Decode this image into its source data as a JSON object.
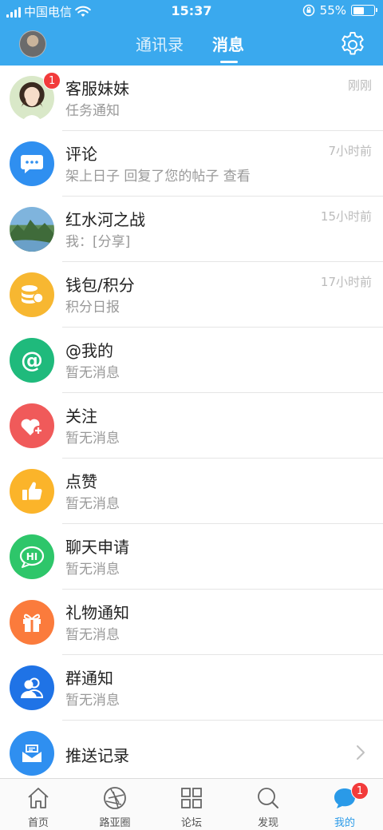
{
  "status_bar": {
    "carrier": "中国电信",
    "time": "15:37",
    "battery_percent": "55%",
    "battery_level": 0.55
  },
  "nav": {
    "tabs": [
      {
        "label": "通讯录",
        "active": false
      },
      {
        "label": "消息",
        "active": true
      }
    ],
    "settings_icon": "gear-icon"
  },
  "messages": [
    {
      "title": "客服妹妹",
      "subtitle": "任务通知",
      "time": "刚刚",
      "badge": "1",
      "icon": "avatar-photo"
    },
    {
      "title": "评论",
      "subtitle": "架上日子 回复了您的帖子   查看",
      "time": "7小时前",
      "icon": "comment-icon",
      "color": "#2f8ff0"
    },
    {
      "title": "红水河之战",
      "subtitle": "我：[分享]",
      "time": "15小时前",
      "icon": "landscape-photo"
    },
    {
      "title": "钱包/积分",
      "subtitle": "积分日报",
      "time": "17小时前",
      "icon": "coins-icon",
      "color": "#f7b731"
    },
    {
      "title": "@我的",
      "subtitle": "暂无消息",
      "time": "",
      "icon": "at-icon",
      "color": "#1fba7c"
    },
    {
      "title": "关注",
      "subtitle": "暂无消息",
      "time": "",
      "icon": "heart-plus-icon",
      "color": "#f05a5a"
    },
    {
      "title": "点赞",
      "subtitle": "暂无消息",
      "time": "",
      "icon": "thumbs-up-icon",
      "color": "#fbb42a"
    },
    {
      "title": "聊天申请",
      "subtitle": "暂无消息",
      "time": "",
      "icon": "chat-hi-icon",
      "color": "#2ec66a"
    },
    {
      "title": "礼物通知",
      "subtitle": "暂无消息",
      "time": "",
      "icon": "gift-icon",
      "color": "#fb7b3c"
    },
    {
      "title": "群通知",
      "subtitle": "暂无消息",
      "time": "",
      "icon": "group-icon",
      "color": "#1f73e6"
    },
    {
      "title": "推送记录",
      "subtitle": "",
      "time": "",
      "icon": "mail-icon",
      "color": "#2f8ff0"
    }
  ],
  "tabbar": [
    {
      "label": "首页",
      "icon": "home-icon",
      "active": false
    },
    {
      "label": "路亚圈",
      "icon": "circle-aperture-icon",
      "active": false
    },
    {
      "label": "论坛",
      "icon": "grid-icon",
      "active": false
    },
    {
      "label": "发现",
      "icon": "search-icon",
      "active": false
    },
    {
      "label": "我的",
      "icon": "chat-bubble-icon",
      "active": true,
      "badge": "1"
    }
  ],
  "colors": {
    "brand": "#3aa9ee",
    "badge": "#f23b3b",
    "active_tab": "#2a9ae8"
  }
}
